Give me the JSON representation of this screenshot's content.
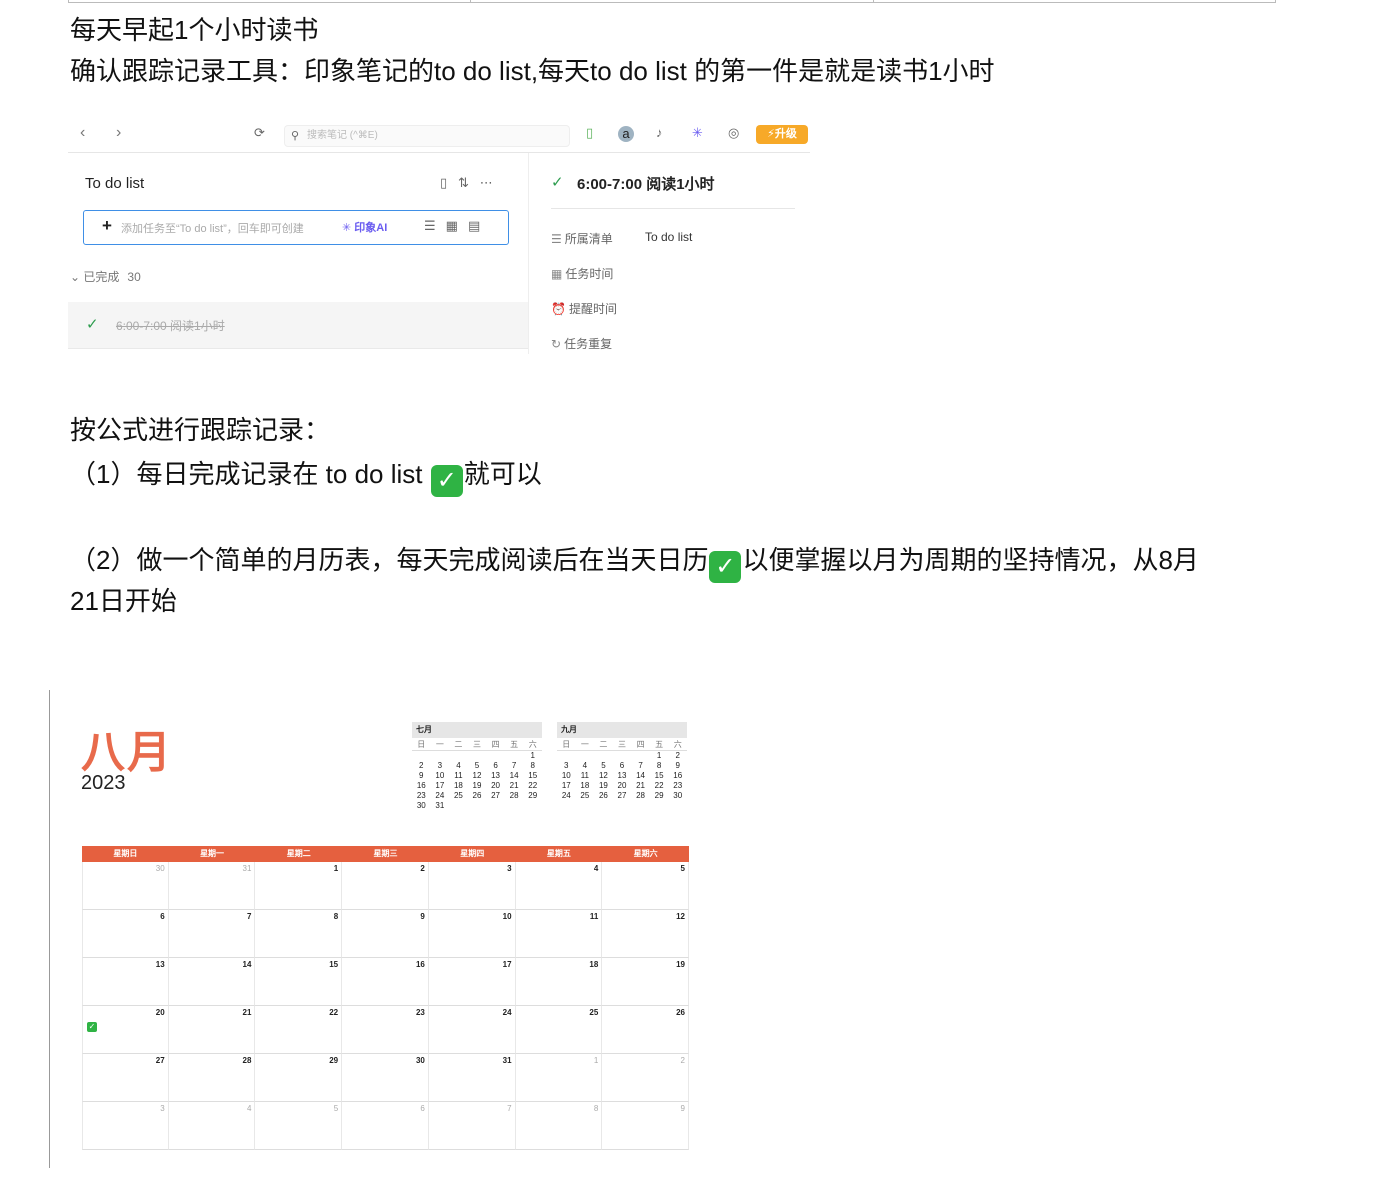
{
  "lines": {
    "l1": "每天早起1个小时读书",
    "l2": "确认跟踪记录工具：印象笔记的to do list,每天to  do list 的第一件是就是读书1小时",
    "l3": "按公式进行跟踪记录：",
    "l4_pre": "（1）每日完成记录在 to do list ",
    "l4_post": "就可以",
    "l5_pre": "（2）做一个简单的月历表，每天完成阅读后在当天日历",
    "l5_post": "以便掌握以月为周期的坚持情况，从8月",
    "l6": "21日开始",
    "check_glyph": "✓"
  },
  "app": {
    "search_placeholder": "搜索笔记 (^⌘E)",
    "upgrade_label": "升级",
    "list_title": "To do list",
    "add_placeholder": "添加任务至“To do list”，回车即可创建",
    "ai_label": "印象AI",
    "done_section": "已完成",
    "done_count": "30",
    "done_task": "6:00-7:00 阅读1小时",
    "detail_title": "6:00-7:00 阅读1小时",
    "fields": [
      {
        "label": "所属清单",
        "value": "To do list",
        "icon": "list-icon"
      },
      {
        "label": "任务时间",
        "value": "",
        "icon": "calendar-icon"
      },
      {
        "label": "提醒时间",
        "value": "",
        "icon": "alarm-icon"
      },
      {
        "label": "任务重复",
        "value": "",
        "icon": "repeat-icon"
      }
    ],
    "accent_color": "#3f8fe6",
    "check_color": "#2e9d4f",
    "upgrade_color": "#f7a928"
  },
  "calendar": {
    "month": "八月",
    "year": "2023",
    "accent_color": "#e5603f",
    "weekday_headers": [
      "星期日",
      "星期一",
      "星期二",
      "星期三",
      "星期四",
      "星期五",
      "星期六"
    ],
    "mini_weekdays": [
      "日",
      "一",
      "二",
      "三",
      "四",
      "五",
      "六"
    ],
    "mini_july": {
      "title": "七月",
      "cells": [
        "",
        "",
        "",
        "",
        "",
        "",
        "1",
        "2",
        "3",
        "4",
        "5",
        "6",
        "7",
        "8",
        "9",
        "10",
        "11",
        "12",
        "13",
        "14",
        "15",
        "16",
        "17",
        "18",
        "19",
        "20",
        "21",
        "22",
        "23",
        "24",
        "25",
        "26",
        "27",
        "28",
        "29",
        "30",
        "31"
      ]
    },
    "mini_sept": {
      "title": "九月",
      "cells": [
        "",
        "",
        "",
        "",
        "",
        "1",
        "2",
        "3",
        "4",
        "5",
        "6",
        "7",
        "8",
        "9",
        "10",
        "11",
        "12",
        "13",
        "14",
        "15",
        "16",
        "17",
        "18",
        "19",
        "20",
        "21",
        "22",
        "23",
        "24",
        "25",
        "26",
        "27",
        "28",
        "29",
        "30"
      ]
    },
    "days": [
      {
        "d": "30",
        "other": true
      },
      {
        "d": "31",
        "other": true
      },
      {
        "d": "1"
      },
      {
        "d": "2"
      },
      {
        "d": "3"
      },
      {
        "d": "4"
      },
      {
        "d": "5"
      },
      {
        "d": "6"
      },
      {
        "d": "7"
      },
      {
        "d": "8"
      },
      {
        "d": "9"
      },
      {
        "d": "10"
      },
      {
        "d": "11"
      },
      {
        "d": "12"
      },
      {
        "d": "13"
      },
      {
        "d": "14"
      },
      {
        "d": "15"
      },
      {
        "d": "16"
      },
      {
        "d": "17"
      },
      {
        "d": "18"
      },
      {
        "d": "19"
      },
      {
        "d": "20",
        "checked": true
      },
      {
        "d": "21"
      },
      {
        "d": "22"
      },
      {
        "d": "23"
      },
      {
        "d": "24"
      },
      {
        "d": "25"
      },
      {
        "d": "26"
      },
      {
        "d": "27"
      },
      {
        "d": "28"
      },
      {
        "d": "29"
      },
      {
        "d": "30"
      },
      {
        "d": "31"
      },
      {
        "d": "1",
        "other": true
      },
      {
        "d": "2",
        "other": true
      },
      {
        "d": "3",
        "other": true
      },
      {
        "d": "4",
        "other": true
      },
      {
        "d": "5",
        "other": true
      },
      {
        "d": "6",
        "other": true
      },
      {
        "d": "7",
        "other": true
      },
      {
        "d": "8",
        "other": true
      },
      {
        "d": "9",
        "other": true
      }
    ]
  }
}
